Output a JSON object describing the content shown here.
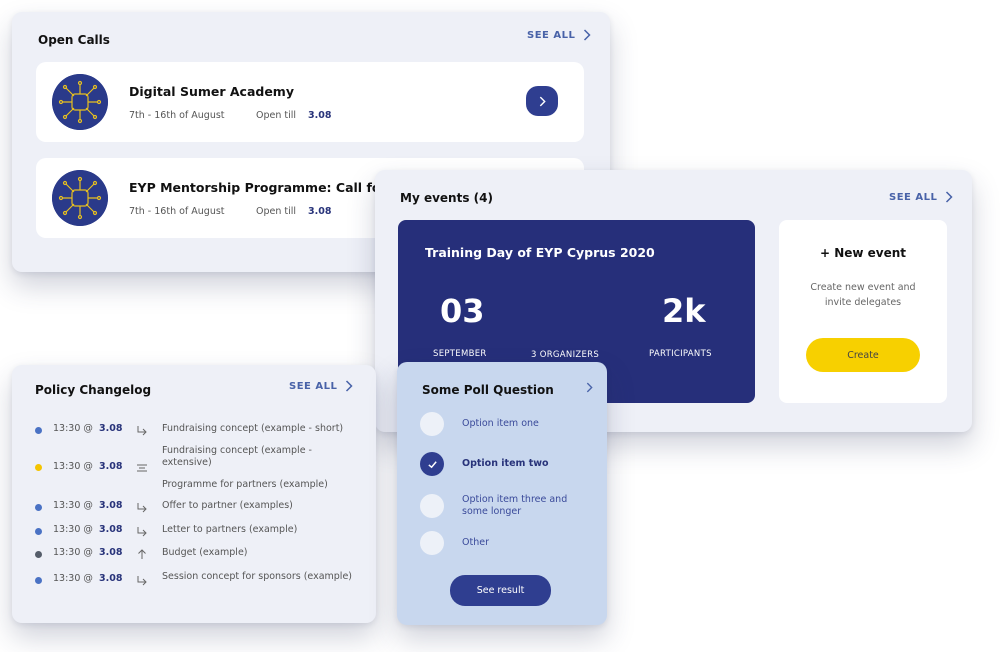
{
  "open_calls": {
    "title": "Open Calls",
    "see_all": "SEE ALL",
    "items": [
      {
        "title": "Digital Sumer Academy",
        "dates": "7th - 16th of August",
        "open_till_label": "Open till",
        "open_till_date": "3.08"
      },
      {
        "title": "EYP Mentorship Programme: Call for I",
        "dates": "7th - 16th of August",
        "open_till_label": "Open till",
        "open_till_date": "3.08"
      }
    ]
  },
  "my_events": {
    "title": "My events (4)",
    "see_all": "SEE ALL",
    "featured": {
      "name": "Training Day of EYP Cyprus 2020",
      "day": "03",
      "month": "SEPTEMBER",
      "organizers": "3 ORGANIZERS",
      "participants_count": "2k",
      "participants_label": "PARTICIPANTS"
    },
    "new_event": {
      "title": "+ New event",
      "description": "Create new event and invite delegates",
      "button": "Create"
    }
  },
  "policy_changelog": {
    "title": "Policy Changelog",
    "see_all": "SEE ALL",
    "entries": [
      {
        "time": "13:30 @",
        "date": "3.08",
        "icon": "arrow-turn-down-right-icon",
        "dot": "#4a72c4",
        "text": "Fundraising concept (example - short)"
      },
      {
        "time": "13:30 @",
        "date": "3.08",
        "icon": "list-lines-icon",
        "dot": "#f4c400",
        "text": "Fundraising concept (example - extensive)",
        "text2": "Programme for partners (example)"
      },
      {
        "time": "13:30 @",
        "date": "3.08",
        "icon": "arrow-turn-down-right-icon",
        "dot": "#4a72c4",
        "text": "Offer to partner (examples)"
      },
      {
        "time": "13:30 @",
        "date": "3.08",
        "icon": "arrow-turn-down-right-icon",
        "dot": "#4a72c4",
        "text": "Letter to partners (example)"
      },
      {
        "time": "13:30 @",
        "date": "3.08",
        "icon": "arrow-up-icon",
        "dot": "#555d6a",
        "text": "Budget (example)"
      },
      {
        "time": "13:30 @",
        "date": "3.08",
        "icon": "arrow-turn-down-right-icon",
        "dot": "#4a72c4",
        "text": "Session concept for sponsors (example)"
      }
    ]
  },
  "poll": {
    "title": "Some Poll Question",
    "options": [
      {
        "label": "Option item one",
        "selected": false
      },
      {
        "label": "Option item two",
        "selected": true
      },
      {
        "label": "Option item three and some longer",
        "selected": false
      },
      {
        "label": "Other",
        "selected": false
      }
    ],
    "button": "See result"
  },
  "colors": {
    "accent_navy": "#262f7a",
    "button_navy": "#2f3e90",
    "create_yellow": "#f7d000",
    "link_blue": "#4862a8",
    "poll_bg": "#c8d7ee"
  }
}
